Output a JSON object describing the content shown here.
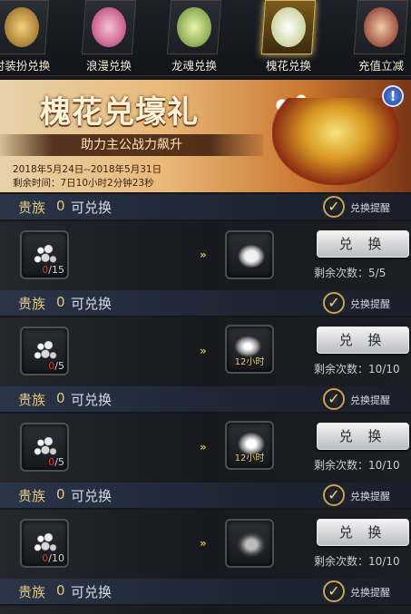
{
  "tabs": [
    {
      "label": "时装扮兑换",
      "active": false,
      "art": "#b8862a"
    },
    {
      "label": "浪漫兑换",
      "active": false,
      "art": "#c43b78"
    },
    {
      "label": "龙魂兑换",
      "active": false,
      "art": "#7ca64a"
    },
    {
      "label": "槐花兑换",
      "active": true,
      "art": "#e8dca4"
    },
    {
      "label": "充值立减",
      "active": false,
      "art": "#9b2b1e"
    }
  ],
  "banner": {
    "title": "槐花兑壕礼",
    "subtitle": "助力主公战力飙升",
    "date": "2018年5月24日--2018年5月31日",
    "remaining": "剩余时间：7日10小时2分钟23秒",
    "info": "!"
  },
  "rows": [
    {
      "noble": "贵族",
      "count": "0",
      "can": "可兑换",
      "remind": "兑换提醒",
      "cost_have": "0",
      "cost_total": "/15",
      "reward_label": "",
      "button": "兑 换",
      "left_label": "剩余次数：",
      "left_value": "5/5"
    },
    {
      "noble": "贵族",
      "count": "0",
      "can": "可兑换",
      "remind": "兑换提醒",
      "cost_have": "0",
      "cost_total": "/5",
      "reward_label": "12小时",
      "button": "兑 换",
      "left_label": "剩余次数：",
      "left_value": "10/10"
    },
    {
      "noble": "贵族",
      "count": "0",
      "can": "可兑换",
      "remind": "兑换提醒",
      "cost_have": "0",
      "cost_total": "/5",
      "reward_label": "12小时",
      "button": "兑 换",
      "left_label": "剩余次数：",
      "left_value": "10/10"
    },
    {
      "noble": "贵族",
      "count": "0",
      "can": "可兑换",
      "remind": "兑换提醒",
      "cost_have": "0",
      "cost_total": "/10",
      "reward_label": "",
      "button": "兑 换",
      "left_label": "剩余次数：",
      "left_value": "10/10"
    }
  ],
  "footer_header": {
    "noble": "贵族",
    "count": "0",
    "can": "可兑换",
    "remind": "兑换提醒"
  },
  "icons": {
    "check": "checkmark-icon",
    "arrow": "double-chevron-right-icon"
  }
}
